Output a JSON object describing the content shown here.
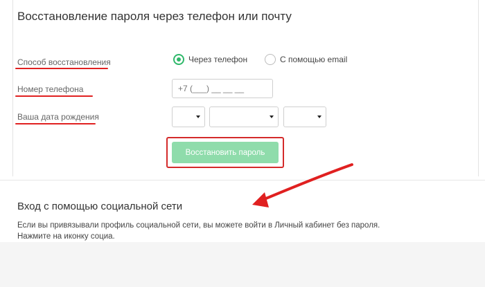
{
  "recovery": {
    "title": "Восстановление пароля через телефон или почту",
    "method_label": "Способ восстановления",
    "phone_label": "Номер телефона",
    "birthdate_label": "Ваша дата рождения",
    "options": [
      {
        "label": "Через телефон",
        "checked": true
      },
      {
        "label": "С помощью email",
        "checked": false
      }
    ],
    "phone_placeholder": "+7 (___) __ __ __",
    "day_value": "",
    "month_value": "",
    "year_value": "",
    "submit_label": "Восстановить пароль"
  },
  "social": {
    "title": "Вход с помощью социальной сети",
    "text_line1": "Если вы привязывали профиль социальной сети, вы можете войти в Личный кабинет без пароля.",
    "text_line2": "Нажмите на иконку социа."
  },
  "colors": {
    "accent_green": "#2fb86a",
    "button_green": "#8fdcab",
    "annotation_red": "#e02020"
  }
}
